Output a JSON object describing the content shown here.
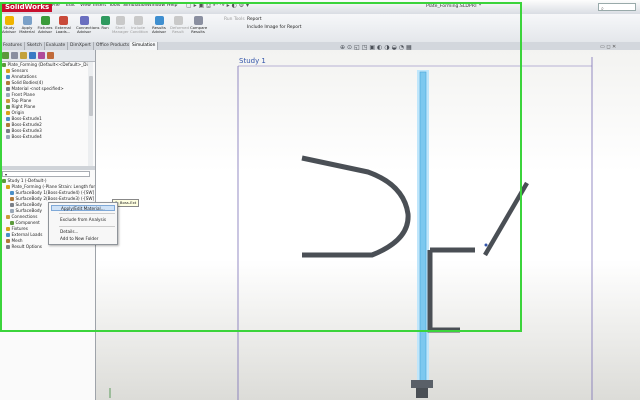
{
  "app": {
    "logo_text": "SolidWorks",
    "document_title": "Plate_Forming.SLDPRT *",
    "search_placeholder": ""
  },
  "menu": [
    "File",
    "Edit",
    "View",
    "Insert",
    "Tools",
    "Simulation",
    "Window",
    "Help"
  ],
  "ribbon": {
    "tools": [
      {
        "label": "Study Advisor"
      },
      {
        "label": "Apply Material"
      },
      {
        "label": "Fixtures Advisor"
      },
      {
        "label": "External Loads..."
      },
      {
        "label": "Connections Advisor"
      },
      {
        "label": "Run"
      },
      {
        "label": "Shell Manager"
      },
      {
        "label": "Deformed Result"
      },
      {
        "label": "Compare Results"
      },
      {
        "label": "Results Advisor"
      },
      {
        "label": "Include Condition"
      },
      {
        "label": "Global Data"
      }
    ],
    "run_tools": "Run Tools",
    "report": "Report",
    "include_image": "Include Image for Report"
  },
  "tabs": [
    {
      "label": "Features",
      "active": false
    },
    {
      "label": "Sketch",
      "active": false
    },
    {
      "label": "Evaluate",
      "active": false
    },
    {
      "label": "DimXpert",
      "active": false
    },
    {
      "label": "Office Products",
      "active": false
    },
    {
      "label": "Simulation",
      "active": true
    }
  ],
  "feature_tree": [
    {
      "label": "Plate_Forming (Default<<Default>_Disp",
      "indent": 0
    },
    {
      "label": "Sensors",
      "indent": 1
    },
    {
      "label": "Annotations",
      "indent": 1
    },
    {
      "label": "Solid Bodies(4)",
      "indent": 1
    },
    {
      "label": "Material <not specified>",
      "indent": 1
    },
    {
      "label": "Front Plane",
      "indent": 1
    },
    {
      "label": "Top Plane",
      "indent": 1
    },
    {
      "label": "Right Plane",
      "indent": 1
    },
    {
      "label": "Origin",
      "indent": 1
    },
    {
      "label": "Boss-Extrude1",
      "indent": 1
    },
    {
      "label": "Boss-Extrude2",
      "indent": 1
    },
    {
      "label": "Boss-Extrude3",
      "indent": 1
    },
    {
      "label": "Boss-Extrude4",
      "indent": 1
    }
  ],
  "study_tree": [
    {
      "label": "Study 1 (-Default-)",
      "indent": 0
    },
    {
      "label": "Plate_Forming (-Plane Strain: Length for",
      "indent": 1
    },
    {
      "label": "SurfaceBody 1(Boss-Extrude4) (-[SW]",
      "indent": 2
    },
    {
      "label": "SurfaceBody 2(Boss-Extrude3) (-[SW]",
      "indent": 2
    },
    {
      "label": "SurfaceBody",
      "indent": 2
    },
    {
      "label": "SurfaceBody",
      "indent": 2
    },
    {
      "label": "Connections",
      "indent": 1
    },
    {
      "label": "Component",
      "indent": 2
    },
    {
      "label": "Fixtures",
      "indent": 1
    },
    {
      "label": "External Loads",
      "indent": 1
    },
    {
      "label": "Mesh",
      "indent": 1
    },
    {
      "label": "Result Options",
      "indent": 1
    }
  ],
  "context_menu": {
    "items": [
      "Apply/Edit Material...",
      "Exclude from Analysis",
      "Details...",
      "Add to New Folder"
    ]
  },
  "tooltip": "3: Boss-Ext",
  "graphics": {
    "study_label": "Study 1"
  },
  "colors": {
    "selection_frame": "#3bd43b",
    "highlight_part": "#8fd3f5",
    "part_dark": "#4a4f55"
  }
}
